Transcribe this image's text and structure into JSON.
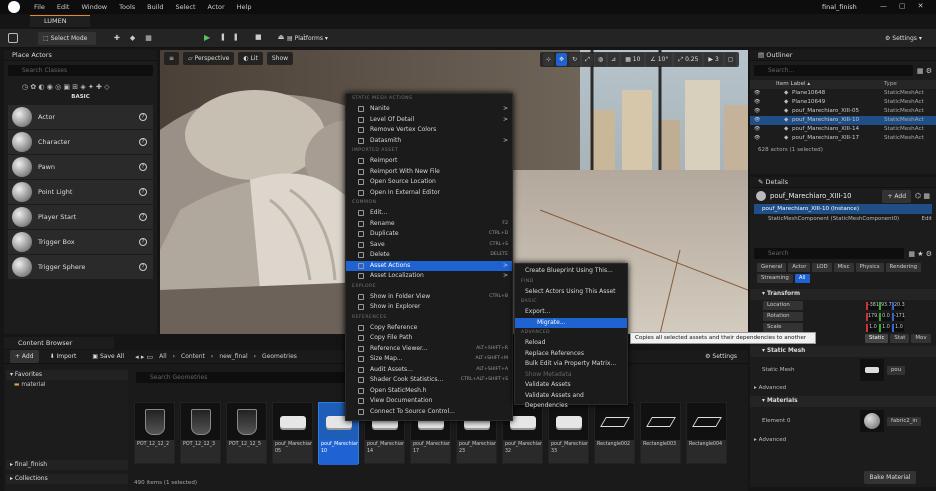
{
  "menubar": {
    "items": [
      "File",
      "Edit",
      "Window",
      "Tools",
      "Build",
      "Select",
      "Actor",
      "Help"
    ],
    "project_title": "final_finish"
  },
  "project_tab": "LUMEN",
  "toolbar": {
    "select_mode": "Select Mode",
    "platforms": "Platforms",
    "settings": "Settings"
  },
  "place_actors": {
    "title": "Place Actors",
    "search_placeholder": "Search Classes",
    "category": "BASIC",
    "items": [
      {
        "label": "Actor"
      },
      {
        "label": "Character"
      },
      {
        "label": "Pawn"
      },
      {
        "label": "Point Light"
      },
      {
        "label": "Player Start"
      },
      {
        "label": "Trigger Box"
      },
      {
        "label": "Trigger Sphere"
      }
    ]
  },
  "viewport": {
    "perspective": "Perspective",
    "lit": "Lit",
    "show": "Show",
    "grid_snap": "10",
    "rot_snap": "10°",
    "scale_snap": "0.25",
    "cam_speed": "3"
  },
  "context_menu": {
    "sections": [
      {
        "title": "STATIC MESH ACTIONS",
        "items": [
          {
            "label": "Nanite",
            "submenu": ">"
          },
          {
            "label": "Level Of Detail",
            "submenu": ">"
          },
          {
            "label": "Remove Vertex Colors"
          },
          {
            "label": "Datasmith",
            "submenu": ">"
          }
        ]
      },
      {
        "title": "IMPORTED ASSET",
        "items": [
          {
            "label": "Reimport"
          },
          {
            "label": "Reimport With New File"
          },
          {
            "label": "Open Source Location"
          },
          {
            "label": "Open In External Editor"
          }
        ]
      },
      {
        "title": "COMMON",
        "items": [
          {
            "label": "Edit..."
          },
          {
            "label": "Rename",
            "shortcut": "F2"
          },
          {
            "label": "Duplicate",
            "shortcut": "CTRL+D"
          },
          {
            "label": "Save",
            "shortcut": "CTRL+S"
          },
          {
            "label": "Delete",
            "shortcut": "DELETE"
          },
          {
            "label": "Asset Actions",
            "submenu": ">",
            "highlight": true
          },
          {
            "label": "Asset Localization",
            "submenu": ">"
          }
        ]
      },
      {
        "title": "EXPLORE",
        "items": [
          {
            "label": "Show in Folder View",
            "shortcut": "CTRL+B"
          },
          {
            "label": "Show in Explorer"
          }
        ]
      },
      {
        "title": "REFERENCES",
        "items": [
          {
            "label": "Copy Reference"
          },
          {
            "label": "Copy File Path"
          },
          {
            "label": "Reference Viewer...",
            "shortcut": "ALT+SHIFT+R"
          },
          {
            "label": "Size Map...",
            "shortcut": "ALT+SHIFT+M"
          },
          {
            "label": "Audit Assets...",
            "shortcut": "ALT+SHIFT+A"
          },
          {
            "label": "Shader Cook Statistics...",
            "shortcut": "CTRL+ALT+SHIFT+S"
          },
          {
            "label": "Open StaticMesh.h"
          },
          {
            "label": "View Documentation"
          },
          {
            "label": "Connect To Source Control..."
          }
        ]
      }
    ]
  },
  "submenu": {
    "sections": [
      {
        "title": "",
        "items": [
          {
            "label": "Create Blueprint Using This..."
          }
        ]
      },
      {
        "title": "FIND",
        "items": [
          {
            "label": "Select Actors Using This Asset"
          }
        ]
      },
      {
        "title": "BASIC",
        "items": [
          {
            "label": "Export..."
          },
          {
            "label": "Migrate...",
            "highlight": true
          }
        ]
      },
      {
        "title": "ADVANCED",
        "items": [
          {
            "label": "Reload"
          },
          {
            "label": "Replace References"
          },
          {
            "label": "Bulk Edit via Property Matrix..."
          },
          {
            "label": "Show Metadata",
            "disabled": true
          },
          {
            "label": "Validate Assets"
          },
          {
            "label": "Validate Assets and Dependencies"
          }
        ]
      }
    ]
  },
  "tooltip": "Copies all selected assets and their dependencies to another project",
  "outliner": {
    "title": "Outliner",
    "search_placeholder": "Search...",
    "col_label": "Item Label",
    "col_type": "Type",
    "rows": [
      {
        "label": "Plane10648",
        "type": "StaticMeshAct"
      },
      {
        "label": "Plane10649",
        "type": "StaticMeshAct"
      },
      {
        "label": "pouf_Marechiaro_XIII-05",
        "type": "StaticMeshAct"
      },
      {
        "label": "pouf_Marechiaro_XIII-10",
        "type": "StaticMeshAct",
        "selected": true
      },
      {
        "label": "pouf_Marechiaro_XIII-14",
        "type": "StaticMeshAct"
      },
      {
        "label": "pouf_Marechiaro_XIII-17",
        "type": "StaticMeshAct"
      }
    ],
    "footer": "628 actors (1 selected)"
  },
  "details": {
    "title": "Details",
    "object_name": "pouf_Marechiaro_XIII-10",
    "add_label": "+ Add",
    "instance": "pouf_Marechiaro_XIII-10 (Instance)",
    "component": "StaticMeshComponent (StaticMeshComponent0)",
    "edit": "Edit",
    "search_placeholder": "Search",
    "filters": [
      "General",
      "Actor",
      "LOD",
      "Misc",
      "Physics",
      "Rendering",
      "Streaming",
      "All"
    ],
    "active_filter": "All",
    "transform": {
      "title": "Transform",
      "location": "Location",
      "rotation": "Rotation",
      "scale": "Scale",
      "loc_vals": [
        "-381",
        "93.7",
        "20.3"
      ],
      "rot_vals": [
        "179.",
        "0.0",
        "-171"
      ],
      "scale_vals": [
        "1.0",
        "1.0",
        "1.0"
      ]
    },
    "mobility": {
      "label": "Mobility",
      "options": [
        "Static",
        "Stat",
        "Mov"
      ]
    },
    "static_mesh": {
      "title": "Static Mesh",
      "label": "Static Mesh",
      "value": "pou"
    },
    "advanced": "Advanced",
    "materials": {
      "title": "Materials",
      "element": "Element 0",
      "value": "fabric2_in"
    },
    "advanced2": "Advanced",
    "bake": "Bake Material"
  },
  "content_browser": {
    "tab": "Content Browser",
    "add": "+ Add",
    "import": "Import",
    "save_all": "Save All",
    "path": [
      "All",
      "Content",
      "new_final",
      "Geometries"
    ],
    "settings": "Settings",
    "favorites": "Favorites",
    "folder": "material",
    "search_placeholder": "Search Geometries",
    "final_finish": "final_finish",
    "collections": "Collections",
    "status": "490 items (1 selected)",
    "assets": [
      {
        "label": "POT_12_12_2"
      },
      {
        "label": "POT_12_12_3"
      },
      {
        "label": "POT_12_12_5"
      },
      {
        "label": "pouf_Marechiaro_XIII-05"
      },
      {
        "label": "pouf_Marechiaro_XIII-10",
        "selected": true
      },
      {
        "label": "pouf_Marechiaro_XIII-14"
      },
      {
        "label": "pouf_Marechiaro_XIII-17"
      },
      {
        "label": "pouf_Marechiaro_XIII-23"
      },
      {
        "label": "pouf_Marechiaro_XIII-32"
      },
      {
        "label": "pouf_Marechiaro_XIII-33"
      },
      {
        "label": "Rectangle002"
      },
      {
        "label": "Rectangle003"
      },
      {
        "label": "Rectangle004"
      }
    ]
  }
}
